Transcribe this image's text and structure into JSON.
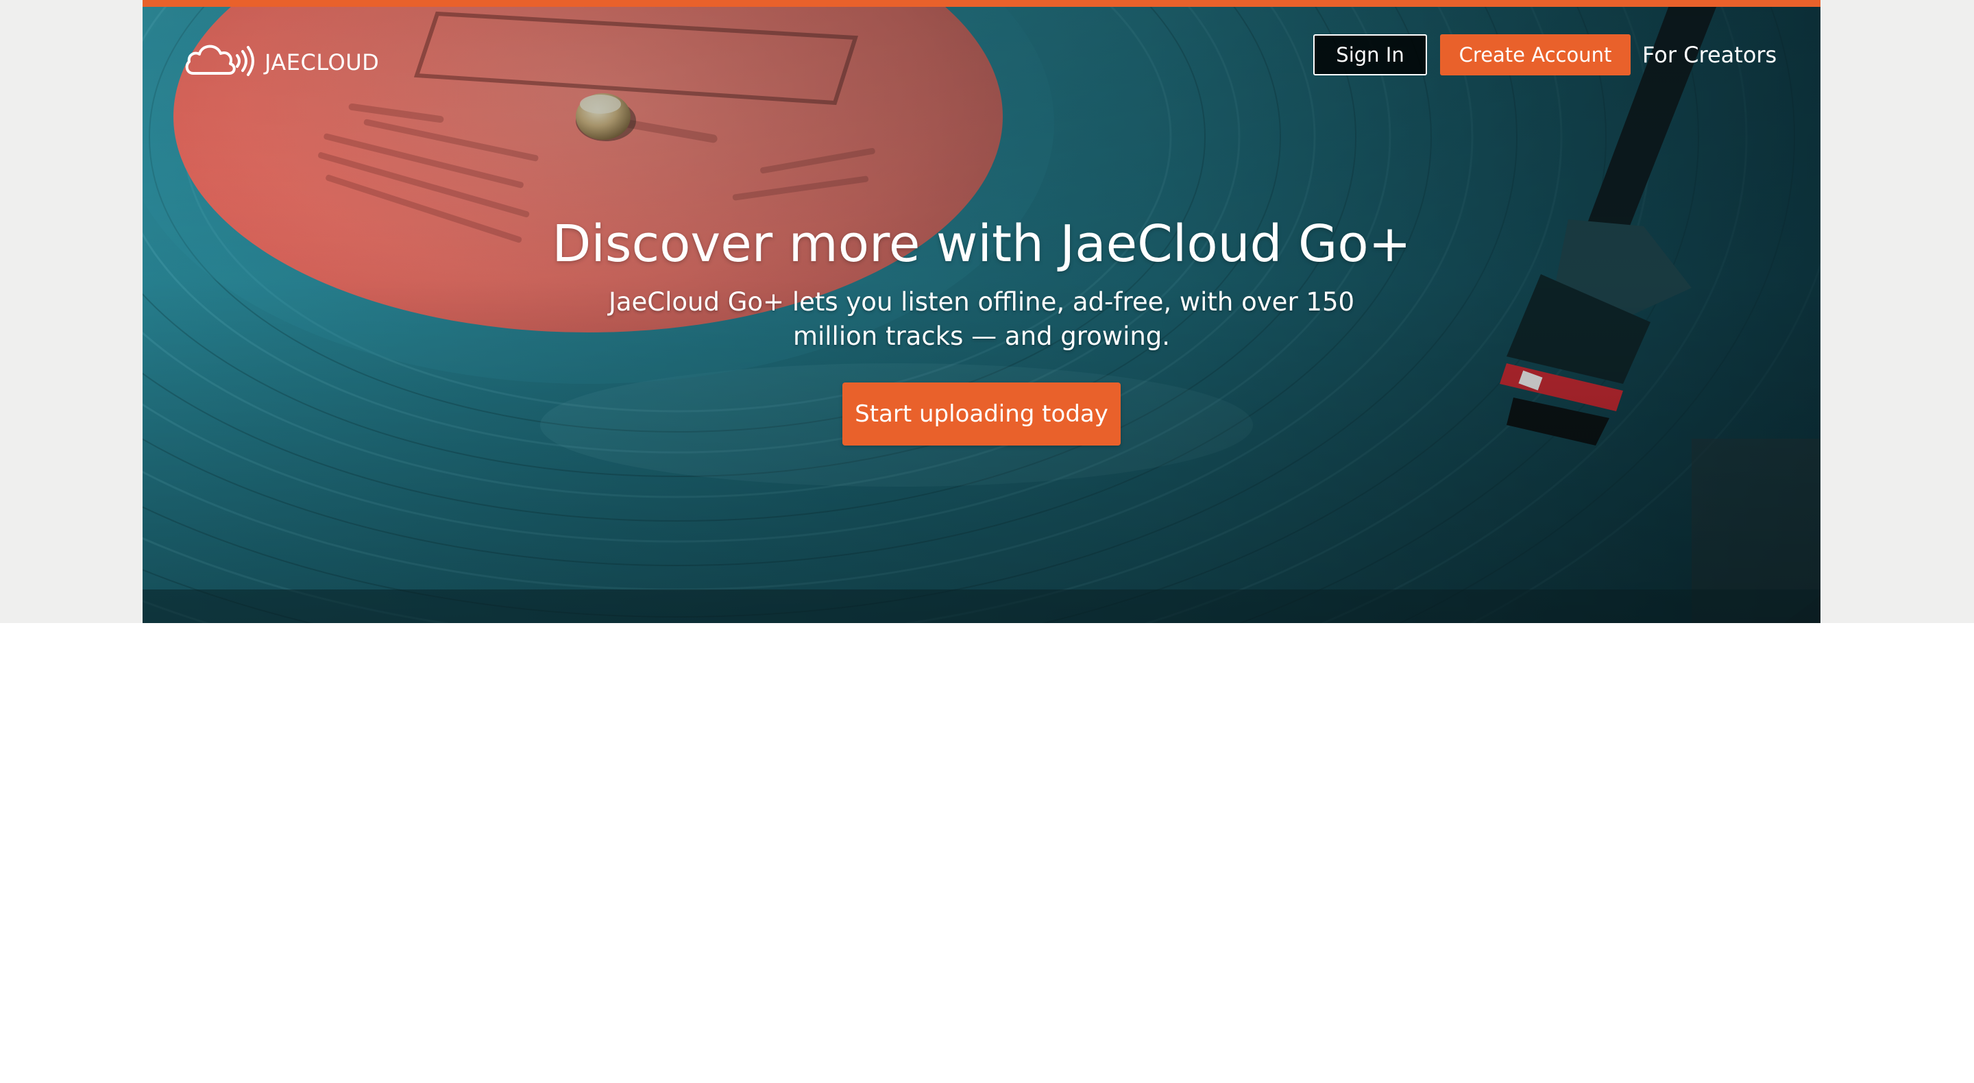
{
  "brand": {
    "name": "JAECLOUD",
    "logo_icon": "cloud-signal-icon"
  },
  "nav": {
    "sign_in_label": "Sign In",
    "create_account_label": "Create Account",
    "for_creators_label": "For Creators"
  },
  "hero": {
    "title": "Discover more with JaeCloud Go+",
    "subtitle": "JaeCloud Go+ lets you listen offline, ad-free, with over 150 million tracks — and growing.",
    "cta_label": "Start uploading today",
    "background_image": "vinyl-record-turntable-image"
  },
  "colors": {
    "accent": "#e9612b",
    "page_band": "#efefee",
    "background": "#ffffff"
  }
}
